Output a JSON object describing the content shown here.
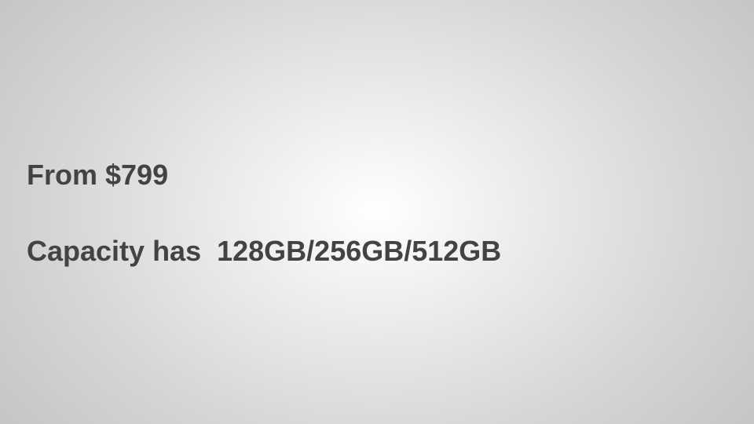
{
  "slide": {
    "background_colors": [
      "#ffffff",
      "#c4c4c4"
    ],
    "text_color": "#434343",
    "lines": [
      "From $799",
      "Capacity has  128GB/256GB/512GB"
    ]
  }
}
